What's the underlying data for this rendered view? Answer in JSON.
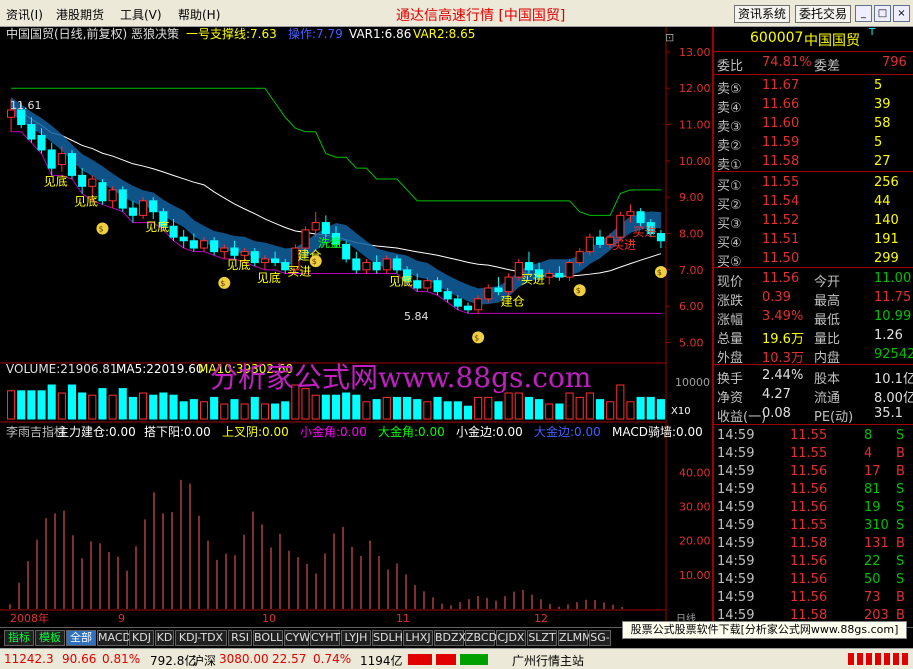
{
  "menu": {
    "items": [
      "资讯(I)",
      "港股期货",
      "工具(V)",
      "帮助(H)"
    ],
    "title": "通达信高速行情 [中国国贸]",
    "btn_info": "资讯系统",
    "btn_trade": "委托交易"
  },
  "chart": {
    "title": "中国国贸(日线,前复权) 恶狼决策",
    "support_label": "一号支撑线:",
    "support_value": "7.63",
    "op_label": "操作:",
    "op_value": "7.79",
    "var1": "VAR1:6.86",
    "var2": "VAR2:8.65",
    "price_ticks": [
      "13.00",
      "12.00",
      "11.00",
      "10.00",
      "9.00",
      "8.00",
      "7.00",
      "6.00",
      "5.00"
    ],
    "high_label": "11.61",
    "low_label": "5.84",
    "annotations": [
      {
        "t": "见底",
        "c": "#ffff00"
      },
      {
        "t": "见底",
        "c": "#ffff00"
      },
      {
        "t": "见底",
        "c": "#ffff00"
      },
      {
        "t": "见底",
        "c": "#ffff00"
      },
      {
        "t": "见底",
        "c": "#ffff00"
      },
      {
        "t": "建仓",
        "c": "#ffff00"
      },
      {
        "t": "买进",
        "c": "#ffff00"
      },
      {
        "t": "洗盘",
        "c": "#00ff00"
      },
      {
        "t": "建仓",
        "c": "#ffff00"
      },
      {
        "t": "买进",
        "c": "#ffff00"
      },
      {
        "t": "见底",
        "c": "#ffff00"
      },
      {
        "t": "买进",
        "c": "#ff3030"
      },
      {
        "t": "买进",
        "c": "#ff3030"
      }
    ],
    "volume_header": {
      "vol": "VOLUME:21906.81",
      "ma5": "MA5:22019.60",
      "ma10": "MA10:39302.60"
    },
    "volume_tick": "10000",
    "volume_mult": "X10",
    "ind_header": [
      {
        "t": "李雨吉指标",
        "c": "#c0c0c0"
      },
      {
        "t": "主力建仓:0.00",
        "c": "#ffffff"
      },
      {
        "t": "搭下阳:0.00",
        "c": "#ffffff"
      },
      {
        "t": "上叉阴:0.00",
        "c": "#ffff00"
      },
      {
        "t": "小金角:0.00",
        "c": "#ff00ff"
      },
      {
        "t": "大金角:0.00",
        "c": "#00ff00"
      },
      {
        "t": "小金边:0.00",
        "c": "#ffffff"
      },
      {
        "t": "大金边:0.00",
        "c": "#4060ff"
      },
      {
        "t": "MACD骑墙:0.00",
        "c": "#ffffff"
      }
    ],
    "ind_ticks": [
      "40.00",
      "30.00",
      "20.00",
      "10.00"
    ],
    "dates": [
      "2008年",
      "9",
      "10",
      "11",
      "12"
    ],
    "day_label": "日线",
    "watermark": "分析家公式网www.88gs.com"
  },
  "quote": {
    "code": "600007",
    "name": "中国国贸",
    "tag": "T",
    "ratio_label": "委比",
    "ratio_value": "74.81%",
    "diff_label": "委差",
    "diff_value": "796",
    "sells": [
      {
        "l": "卖⑤",
        "p": "11.67",
        "v": "5"
      },
      {
        "l": "卖④",
        "p": "11.66",
        "v": "39"
      },
      {
        "l": "卖③",
        "p": "11.60",
        "v": "58"
      },
      {
        "l": "卖②",
        "p": "11.59",
        "v": "5"
      },
      {
        "l": "卖①",
        "p": "11.58",
        "v": "27"
      }
    ],
    "buys": [
      {
        "l": "买①",
        "p": "11.55",
        "v": "256"
      },
      {
        "l": "买②",
        "p": "11.54",
        "v": "44"
      },
      {
        "l": "买③",
        "p": "11.52",
        "v": "140"
      },
      {
        "l": "买④",
        "p": "11.51",
        "v": "191"
      },
      {
        "l": "买⑤",
        "p": "11.50",
        "v": "299"
      }
    ],
    "stats": [
      [
        {
          "t": "现价",
          "c": "ql"
        },
        {
          "t": "11.56",
          "c": "qr"
        },
        {
          "t": "今开",
          "c": "ql"
        },
        {
          "t": "11.00",
          "c": "qg"
        }
      ],
      [
        {
          "t": "涨跌",
          "c": "ql"
        },
        {
          "t": "0.39",
          "c": "qr"
        },
        {
          "t": "最高",
          "c": "ql"
        },
        {
          "t": "11.75",
          "c": "qr"
        }
      ],
      [
        {
          "t": "涨幅",
          "c": "ql"
        },
        {
          "t": "3.49%",
          "c": "qr"
        },
        {
          "t": "最低",
          "c": "ql"
        },
        {
          "t": "10.99",
          "c": "qg"
        }
      ],
      [
        {
          "t": "总量",
          "c": "ql"
        },
        {
          "t": "19.6万",
          "c": "qy"
        },
        {
          "t": "量比",
          "c": "ql"
        },
        {
          "t": "1.26",
          "c": "qw"
        }
      ],
      [
        {
          "t": "外盘",
          "c": "ql"
        },
        {
          "t": "10.3万",
          "c": "qr"
        },
        {
          "t": "内盘",
          "c": "ql"
        },
        {
          "t": "92542",
          "c": "qg"
        }
      ]
    ],
    "fund": [
      [
        {
          "t": "换手",
          "c": "ql"
        },
        {
          "t": "2.44%",
          "c": "qw"
        },
        {
          "t": "股本",
          "c": "ql"
        },
        {
          "t": "10.1亿",
          "c": "qw"
        }
      ],
      [
        {
          "t": "净资",
          "c": "ql"
        },
        {
          "t": "4.27",
          "c": "qw"
        },
        {
          "t": "流通",
          "c": "ql"
        },
        {
          "t": "8.00亿",
          "c": "qw"
        }
      ],
      [
        {
          "t": "收益(一)",
          "c": "ql"
        },
        {
          "t": "0.08",
          "c": "qw"
        },
        {
          "t": "PE(动)",
          "c": "ql"
        },
        {
          "t": "35.1",
          "c": "qw"
        }
      ]
    ],
    "ticks": [
      {
        "t": "14:59",
        "p": "11.55",
        "v": "8",
        "s": "S"
      },
      {
        "t": "14:59",
        "p": "11.55",
        "v": "4",
        "s": "B"
      },
      {
        "t": "14:59",
        "p": "11.56",
        "v": "17",
        "s": "B"
      },
      {
        "t": "14:59",
        "p": "11.56",
        "v": "81",
        "s": "S"
      },
      {
        "t": "14:59",
        "p": "11.56",
        "v": "19",
        "s": "S"
      },
      {
        "t": "14:59",
        "p": "11.55",
        "v": "310",
        "s": "S"
      },
      {
        "t": "14:59",
        "p": "11.58",
        "v": "131",
        "s": "B"
      },
      {
        "t": "14:59",
        "p": "11.56",
        "v": "22",
        "s": "S"
      },
      {
        "t": "14:59",
        "p": "11.56",
        "v": "50",
        "s": "S"
      },
      {
        "t": "14:59",
        "p": "11.56",
        "v": "73",
        "s": "B"
      },
      {
        "t": "14:59",
        "p": "11.58",
        "v": "203",
        "s": "B"
      }
    ]
  },
  "tabs": [
    "指标",
    "模板",
    "全部",
    "MACD",
    "KDJ",
    "KD",
    "KDJ-TDX",
    "RSI",
    "BOLL",
    "CYW",
    "CYHT",
    "LYJH",
    "SDLH",
    "LHXJ",
    "BDZX",
    "ZBCD",
    "CJDX",
    "SLZT",
    "ZLMM",
    "SG-"
  ],
  "promo": "股票公式股票软件下载[分析家公式网www.88gs.com]",
  "status": {
    "sh_index": "11242.3",
    "sh_change": "90.66",
    "sh_pct": "0.81%",
    "sh_amount": "792.8亿",
    "sz_label": "沪深",
    "sz_index": "3080.00",
    "sz_change": "22.57",
    "sz_pct": "0.74%",
    "sz_amount": "1194亿",
    "station": "广州行情主站"
  },
  "colors": {
    "up": "#ff3030",
    "down": "#00ffff",
    "up_text": "#e03030",
    "down_text": "#00c000",
    "border": "#a00000",
    "ma_white": "#ffffff",
    "support_green": "#00c000",
    "magenta": "#c000c0"
  },
  "chart_data": {
    "type": "candlestick",
    "title": "中国国贸(日线,前复权) 恶狼决策",
    "ylim": [
      4.6,
      13.3
    ],
    "ohlc": [
      [
        11.2,
        11.7,
        10.8,
        11.4
      ],
      [
        11.4,
        11.6,
        10.9,
        11.0
      ],
      [
        11.0,
        11.2,
        10.5,
        10.6
      ],
      [
        10.7,
        10.9,
        10.2,
        10.3
      ],
      [
        10.3,
        10.5,
        9.6,
        9.8
      ],
      [
        9.9,
        10.4,
        9.7,
        10.2
      ],
      [
        10.2,
        10.3,
        9.5,
        9.6
      ],
      [
        9.6,
        9.8,
        9.1,
        9.3
      ],
      [
        9.3,
        9.6,
        8.9,
        9.5
      ],
      [
        9.4,
        9.5,
        8.8,
        8.9
      ],
      [
        8.9,
        9.3,
        8.7,
        9.2
      ],
      [
        9.2,
        9.3,
        8.6,
        8.7
      ],
      [
        8.7,
        8.9,
        8.3,
        8.5
      ],
      [
        8.5,
        9.0,
        8.4,
        8.9
      ],
      [
        8.9,
        9.0,
        8.4,
        8.6
      ],
      [
        8.6,
        8.7,
        8.1,
        8.2
      ],
      [
        8.2,
        8.4,
        7.8,
        7.9
      ],
      [
        7.9,
        8.1,
        7.6,
        7.8
      ],
      [
        7.8,
        8.0,
        7.5,
        7.6
      ],
      [
        7.6,
        7.9,
        7.5,
        7.8
      ],
      [
        7.8,
        7.9,
        7.4,
        7.5
      ],
      [
        7.5,
        7.7,
        7.3,
        7.6
      ],
      [
        7.6,
        7.8,
        7.3,
        7.4
      ],
      [
        7.4,
        7.6,
        7.2,
        7.5
      ],
      [
        7.5,
        7.6,
        7.1,
        7.2
      ],
      [
        7.2,
        7.4,
        7.0,
        7.3
      ],
      [
        7.3,
        7.5,
        7.1,
        7.2
      ],
      [
        7.2,
        7.3,
        6.9,
        7.0
      ],
      [
        7.0,
        7.7,
        6.9,
        7.6
      ],
      [
        7.6,
        8.2,
        7.5,
        8.1
      ],
      [
        8.1,
        8.6,
        7.9,
        8.3
      ],
      [
        8.3,
        8.5,
        7.9,
        8.0
      ],
      [
        8.0,
        8.2,
        7.6,
        7.7
      ],
      [
        7.7,
        7.8,
        7.2,
        7.3
      ],
      [
        7.3,
        7.5,
        6.9,
        7.0
      ],
      [
        7.0,
        7.3,
        6.9,
        7.2
      ],
      [
        7.2,
        7.4,
        6.9,
        7.0
      ],
      [
        7.0,
        7.4,
        6.9,
        7.3
      ],
      [
        7.3,
        7.4,
        6.9,
        7.0
      ],
      [
        7.0,
        7.1,
        6.6,
        6.7
      ],
      [
        6.7,
        6.9,
        6.4,
        6.5
      ],
      [
        6.5,
        6.8,
        6.4,
        6.7
      ],
      [
        6.7,
        6.8,
        6.3,
        6.4
      ],
      [
        6.4,
        6.5,
        6.1,
        6.2
      ],
      [
        6.2,
        6.3,
        5.9,
        6.0
      ],
      [
        6.0,
        6.1,
        5.8,
        5.9
      ],
      [
        5.9,
        6.3,
        5.8,
        6.2
      ],
      [
        6.2,
        6.6,
        6.1,
        6.5
      ],
      [
        6.5,
        6.8,
        6.3,
        6.4
      ],
      [
        6.4,
        6.9,
        6.3,
        6.8
      ],
      [
        6.8,
        7.3,
        6.7,
        7.2
      ],
      [
        7.2,
        7.5,
        6.9,
        7.0
      ],
      [
        7.0,
        7.2,
        6.7,
        6.8
      ],
      [
        6.8,
        7.0,
        6.6,
        6.9
      ],
      [
        6.9,
        7.1,
        6.7,
        6.8
      ],
      [
        6.8,
        7.3,
        6.7,
        7.2
      ],
      [
        7.2,
        7.6,
        7.1,
        7.5
      ],
      [
        7.5,
        8.0,
        7.4,
        7.9
      ],
      [
        7.9,
        8.1,
        7.6,
        7.7
      ],
      [
        7.7,
        8.0,
        7.6,
        7.9
      ],
      [
        7.9,
        8.6,
        7.8,
        8.5
      ],
      [
        8.5,
        8.8,
        8.3,
        8.6
      ],
      [
        8.6,
        8.7,
        8.2,
        8.3
      ],
      [
        8.3,
        8.4,
        7.9,
        8.0
      ],
      [
        8.0,
        8.1,
        7.6,
        7.8
      ]
    ],
    "series": [
      {
        "name": "VAR1",
        "values": [
          6.86
        ]
      },
      {
        "name": "VAR2",
        "values": [
          8.65
        ]
      }
    ],
    "volume": {
      "ma5": 22019.6,
      "ma10": 39302.6,
      "last": 21906.81
    },
    "indicator_ylim": [
      0,
      48
    ]
  }
}
